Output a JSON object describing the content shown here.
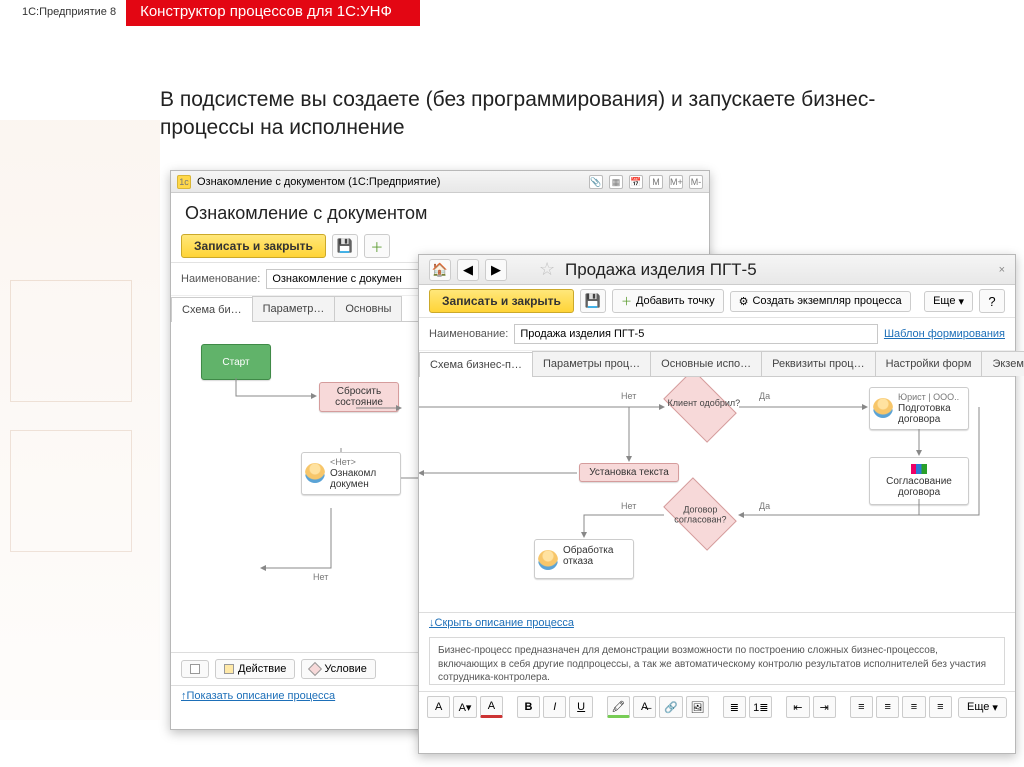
{
  "header": {
    "brand": "1С:Предприятие 8",
    "title": "Конструктор процессов для 1С:УНФ"
  },
  "lead": "В подсистеме вы создаете (без программирования) и запускаете бизнес-процессы на исполнение",
  "win1": {
    "titlebar": "Ознакомление с документом (1С:Предприятие)",
    "mem_m": "M",
    "mem_mp": "M+",
    "mem_mm": "M-",
    "title": "Ознакомление с документом",
    "save_close": "Записать и закрыть",
    "name_label": "Наименование:",
    "name_value": "Ознакомление с докумен",
    "tabs": [
      "Схема би…",
      "Параметр…",
      "Основны"
    ],
    "nodes": {
      "start": "Старт",
      "reset": "Сбросить состояние",
      "none_head": "<Нет>",
      "none_body": "Ознакомл докумен"
    },
    "edge_no": "Нет",
    "tools": {
      "action": "Действие",
      "cond": "Условие"
    },
    "show_desc": "↑Показать описание процесса"
  },
  "win2": {
    "title": "Продажа изделия ПГТ-5",
    "save_close": "Записать и закрыть",
    "add_point": "Добавить точку",
    "create_inst": "Создать экземпляр процесса",
    "more": "Еще",
    "help": "?",
    "name_label": "Наименование:",
    "name_value": "Продажа изделия ПГТ-5",
    "template_link": "Шаблон формирования",
    "tabs": [
      "Схема бизнес-п…",
      "Параметры проц…",
      "Основные испо…",
      "Реквизиты проц…",
      "Настройки форм",
      "Экземпляры"
    ],
    "nodes": {
      "q1": "Клиент одобрил?",
      "set_text": "Установка текста",
      "q2": "Договор согласован?",
      "reject_head": "",
      "reject_body": "Обработка отказа",
      "law_head": "Юрист | ООО..",
      "law_body": "Подготовка договора",
      "agree": "Согласование договора"
    },
    "labels": {
      "yes": "Да",
      "no": "Нет"
    },
    "hide_desc": "↓Скрыть описание процесса",
    "desc_text": "Бизнес-процесс предназначен для демонстрации возможности по построению сложных бизнес-процессов, включающих в себя другие подпроцессы, а так же автоматическому контролю результатов исполнителей без участия сотрудника-контролера.",
    "fmt_more": "Еще"
  }
}
